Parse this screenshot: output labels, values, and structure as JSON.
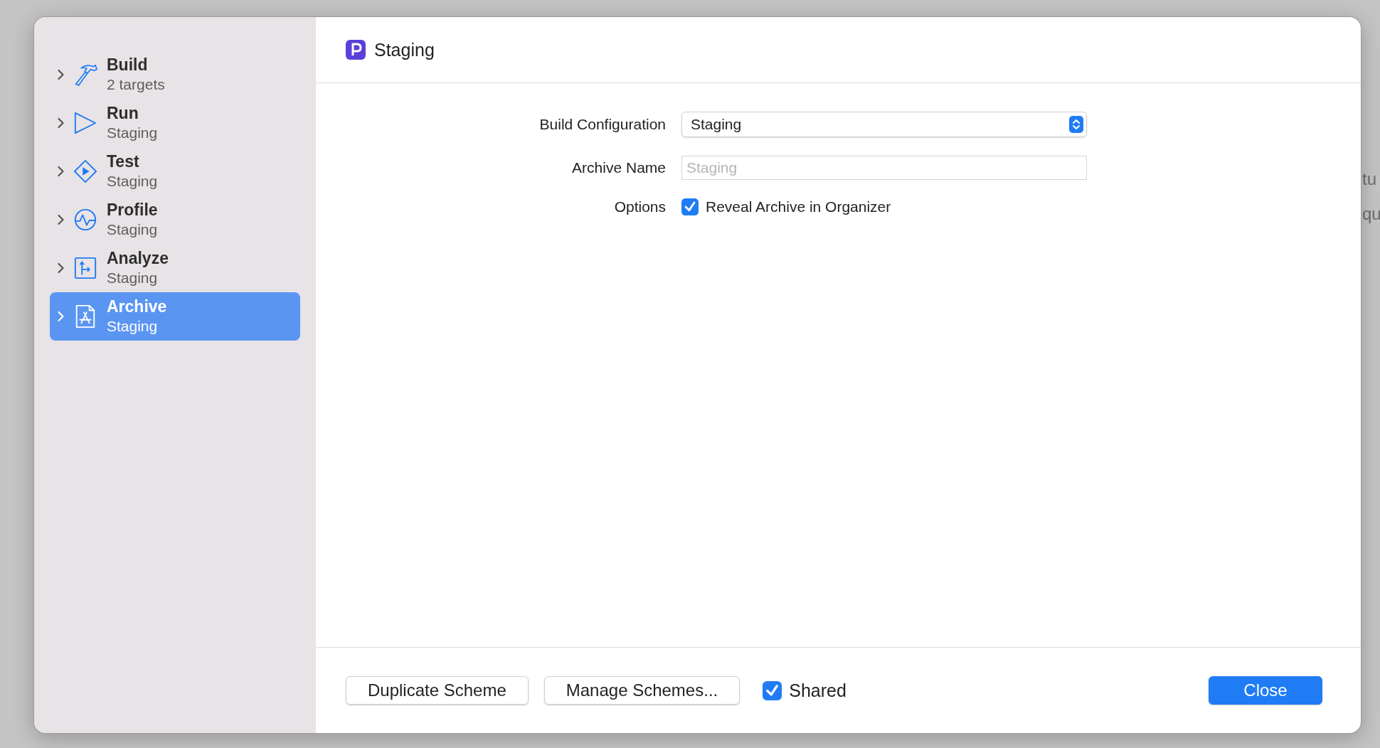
{
  "background": {
    "texts": [
      "tu",
      "qu"
    ]
  },
  "sidebar": {
    "items": [
      {
        "kind": "build",
        "title": "Build",
        "subtitle": "2 targets",
        "selected": false
      },
      {
        "kind": "run",
        "title": "Run",
        "subtitle": "Staging",
        "selected": false
      },
      {
        "kind": "test",
        "title": "Test",
        "subtitle": "Staging",
        "selected": false
      },
      {
        "kind": "profile",
        "title": "Profile",
        "subtitle": "Staging",
        "selected": false
      },
      {
        "kind": "analyze",
        "title": "Analyze",
        "subtitle": "Staging",
        "selected": false
      },
      {
        "kind": "archive",
        "title": "Archive",
        "subtitle": "Staging",
        "selected": true
      }
    ]
  },
  "header": {
    "scheme": "Staging"
  },
  "form": {
    "build_configuration": {
      "label": "Build Configuration",
      "value": "Staging"
    },
    "archive_name": {
      "label": "Archive Name",
      "placeholder": "Staging"
    },
    "options": {
      "label": "Options",
      "checkbox": {
        "label": "Reveal Archive in Organizer",
        "checked": true
      }
    }
  },
  "footer": {
    "duplicate": "Duplicate Scheme",
    "manage": "Manage Schemes...",
    "shared": {
      "label": "Shared",
      "checked": true
    },
    "close": "Close"
  }
}
